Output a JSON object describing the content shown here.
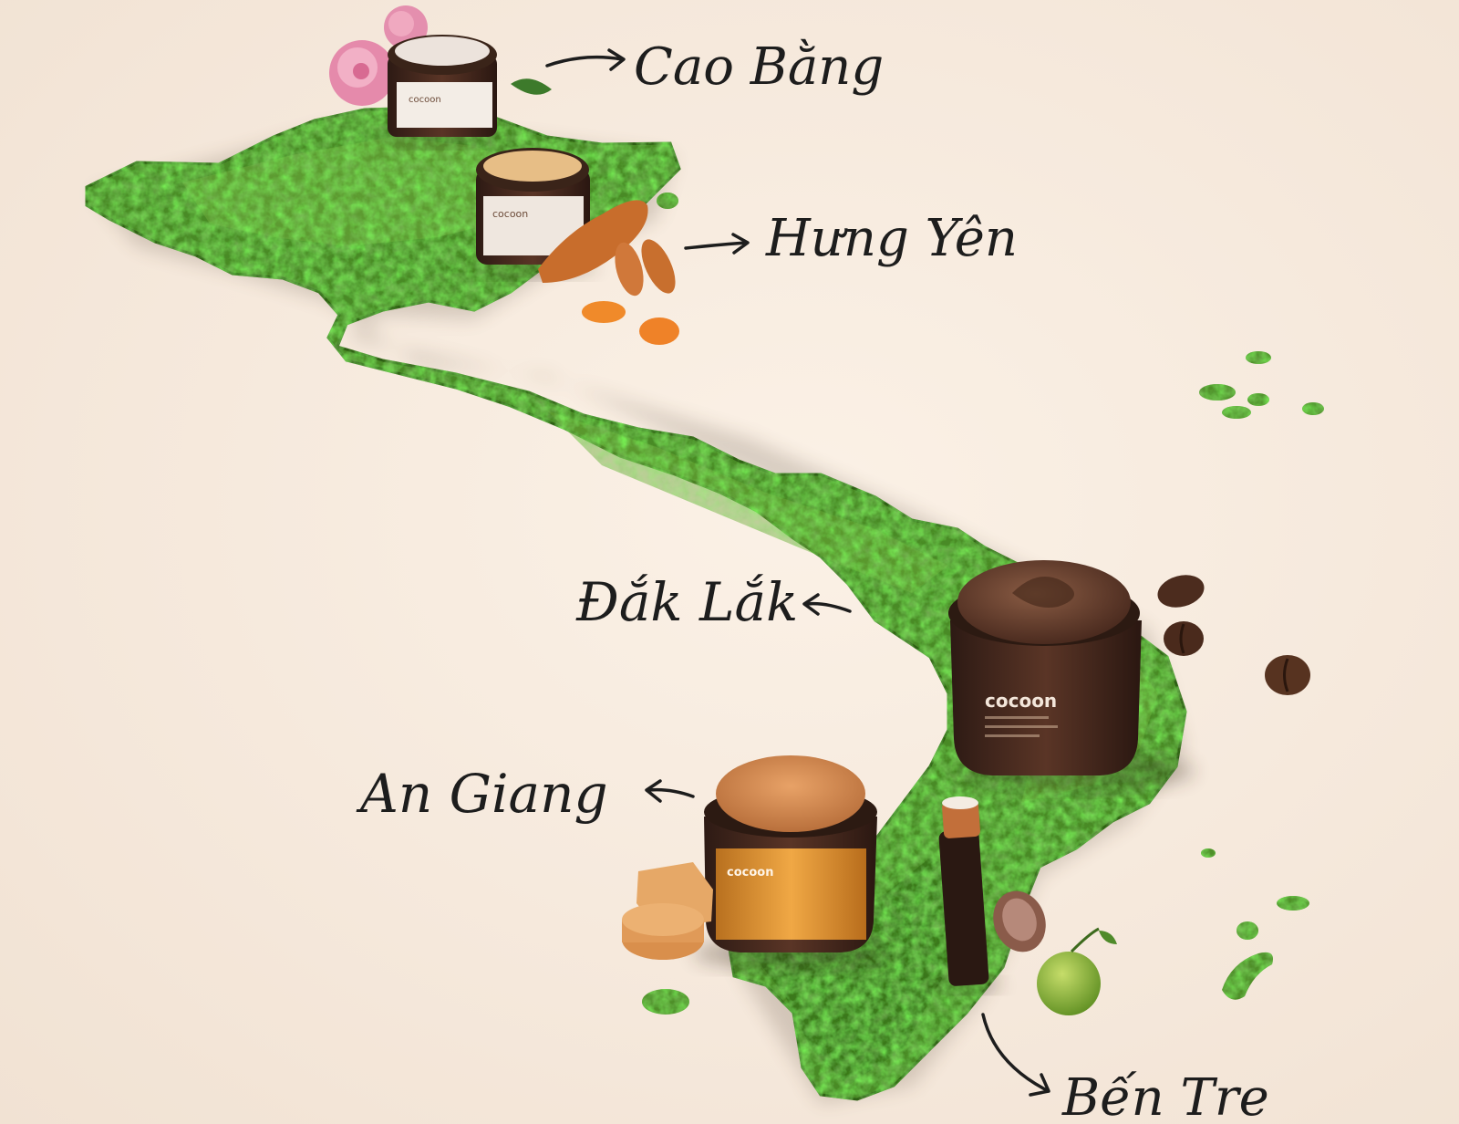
{
  "labels": {
    "cao_bang": "Cao Bằng",
    "hung_yen": "Hưng Yên",
    "dak_lak": "Đắk Lắk",
    "an_giang": "An Giang",
    "ben_tre": "Bến Tre"
  },
  "brand": {
    "name": "cocoon"
  },
  "colors": {
    "background": "#f6eadd",
    "moss": "#3f7a22",
    "moss_light": "#6fa83a",
    "ink": "#1d1d1d",
    "jar_brown": "#4a2c20",
    "jar_orange": "#e39a3a",
    "coffee": "#5b3a2a"
  }
}
